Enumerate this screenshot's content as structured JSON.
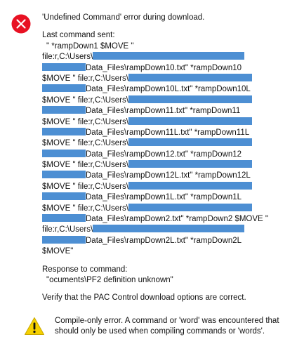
{
  "error_dialog": {
    "icon": "error-x-icon",
    "title": "'Undefined Command' error during download.",
    "last_command_label": "Last command sent:",
    "command_lines": [
      [
        "\" *rampDown1 $MOVE \"",
        ""
      ],
      [
        "file:r,C:\\Users\\",
        ""
      ],
      [
        "",
        "Data_Files\\rampDown10.txt\" *rampDown10"
      ],
      [
        "$MOVE \" file:r,C:\\Users\\",
        ""
      ],
      [
        "",
        "Data_Files\\rampDown10L.txt\" *rampDown10L"
      ],
      [
        "$MOVE \" file:r,C:\\Users\\",
        ""
      ],
      [
        "",
        "Data_Files\\rampDown11.txt\" *rampDown11"
      ],
      [
        "$MOVE \" file:r,C:\\Users\\",
        ""
      ],
      [
        "",
        "Data_Files\\rampDown11L.txt\" *rampDown11L"
      ],
      [
        "$MOVE \" file:r,C:\\Users\\",
        ""
      ],
      [
        "",
        "Data_Files\\rampDown12.txt\" *rampDown12"
      ],
      [
        "$MOVE \" file:r,C:\\Users\\",
        ""
      ],
      [
        "",
        "Data_Files\\rampDown12L.txt\" *rampDown12L"
      ],
      [
        "$MOVE \" file:r,C:\\Users\\",
        ""
      ],
      [
        "",
        "Data_Files\\rampDown1L.txt\" *rampDown1L"
      ],
      [
        "$MOVE \" file:r,C:\\Users\\",
        ""
      ],
      [
        "",
        "Data_Files\\rampDown2.txt\" *rampDown2 $MOVE \""
      ],
      [
        "file:r,C:\\Users\\",
        ""
      ],
      [
        "",
        "Data_Files\\rampDown2L.txt\" *rampDown2L"
      ],
      [
        "$MOVE\"",
        ""
      ]
    ],
    "response_label": "Response to command:",
    "response_value": "\"ocuments\\PF2 definition unknown\"",
    "verify_text": "Verify that the PAC Control download options are correct."
  },
  "warning": {
    "icon": "warning-triangle-icon",
    "text": "Compile-only error. A command or 'word' was encountered that should only be used when compiling commands or 'words'."
  },
  "colors": {
    "redaction": "#4d8fd3",
    "error_red": "#e81123",
    "warning_yellow": "#f5d000"
  }
}
